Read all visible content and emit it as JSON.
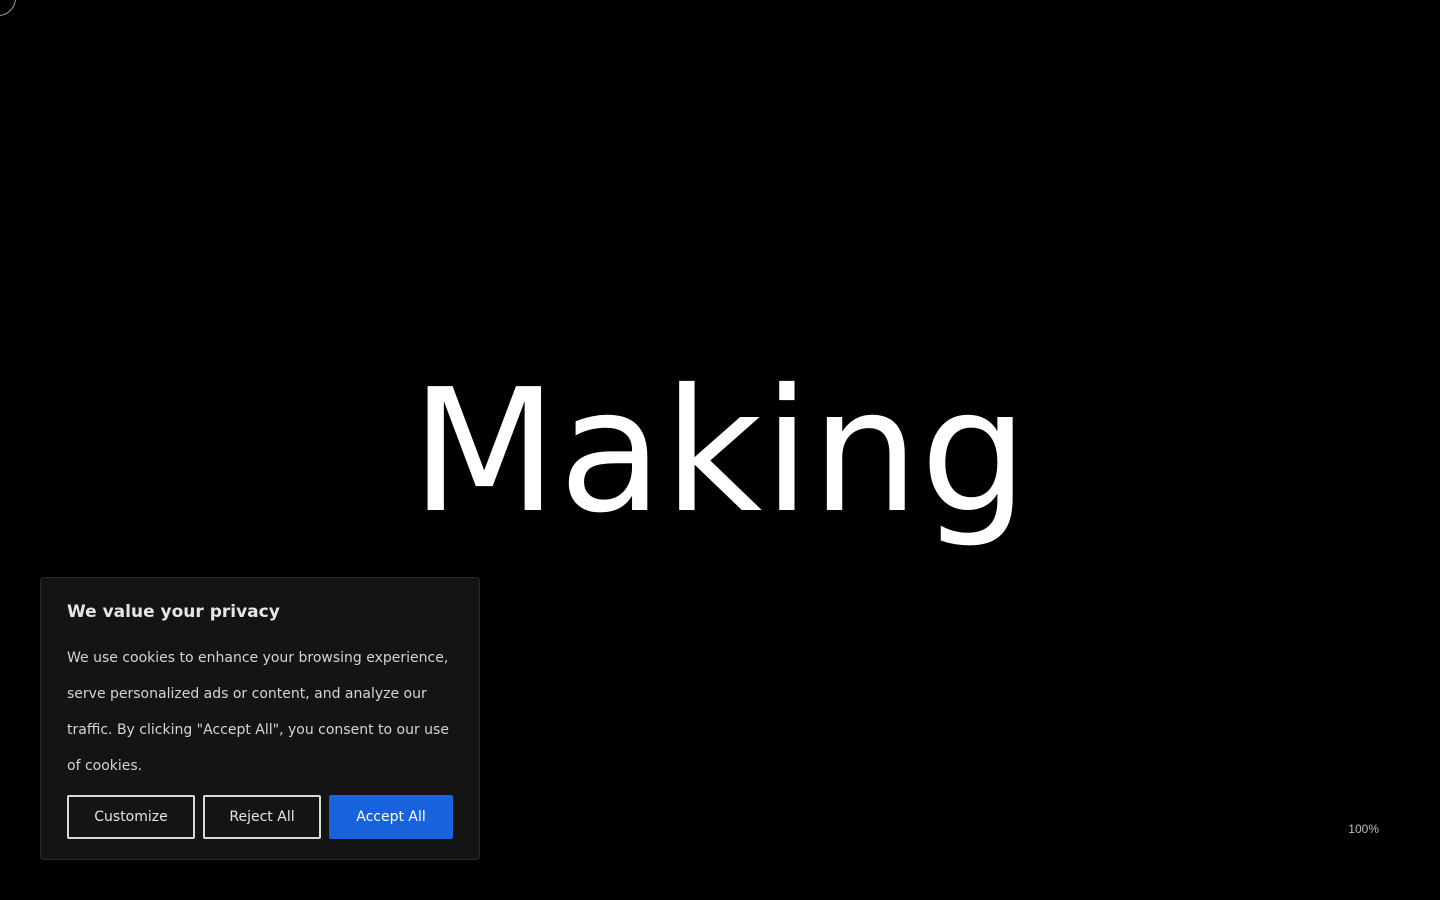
{
  "hero": {
    "word": "Making"
  },
  "loader": {
    "percent_label": "100%"
  },
  "cookie_banner": {
    "title": "We value your privacy",
    "text": "We use cookies to enhance your browsing experience, serve personalized ads or content, and analyze our traffic. By clicking \"Accept All\", you consent to our use of cookies.",
    "buttons": {
      "customize": "Customize",
      "reject_all": "Reject All",
      "accept_all": "Accept All"
    }
  },
  "colors": {
    "background": "#000000",
    "banner_background": "#141414",
    "accent": "#1863dc",
    "text": "#ffffff"
  },
  "icons": {
    "cursor": "cursor-ring-icon"
  }
}
